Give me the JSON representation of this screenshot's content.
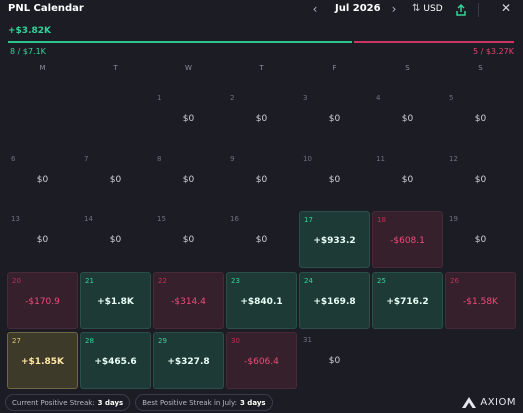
{
  "header": {
    "title": "PNL Calendar",
    "month": "Jul 2026",
    "currency": "USD",
    "icons": [
      "chevron-left-icon",
      "chevron-right-icon",
      "swap-icon",
      "share-icon",
      "close-icon"
    ]
  },
  "summary": {
    "total": "+$3.82K",
    "wins": "8 / $7.1K",
    "losses": "5 / $3.27K",
    "win_fraction": 0.68,
    "colors": {
      "positive": "#35d39a",
      "negative": "#e1456f"
    }
  },
  "weekdays": [
    "M",
    "T",
    "W",
    "T",
    "F",
    "S",
    "S"
  ],
  "weeks": [
    [
      null,
      null,
      {
        "day": "1",
        "value": "$0",
        "kind": "zero"
      },
      {
        "day": "2",
        "value": "$0",
        "kind": "zero"
      },
      {
        "day": "3",
        "value": "$0",
        "kind": "zero"
      },
      {
        "day": "4",
        "value": "$0",
        "kind": "zero"
      },
      {
        "day": "5",
        "value": "$0",
        "kind": "zero"
      }
    ],
    [
      {
        "day": "6",
        "value": "$0",
        "kind": "zero"
      },
      {
        "day": "7",
        "value": "$0",
        "kind": "zero"
      },
      {
        "day": "8",
        "value": "$0",
        "kind": "zero"
      },
      {
        "day": "9",
        "value": "$0",
        "kind": "zero"
      },
      {
        "day": "10",
        "value": "$0",
        "kind": "zero"
      },
      {
        "day": "11",
        "value": "$0",
        "kind": "zero"
      },
      {
        "day": "12",
        "value": "$0",
        "kind": "zero"
      }
    ],
    [
      {
        "day": "13",
        "value": "$0",
        "kind": "zero"
      },
      {
        "day": "14",
        "value": "$0",
        "kind": "zero"
      },
      {
        "day": "15",
        "value": "$0",
        "kind": "zero"
      },
      {
        "day": "16",
        "value": "$0",
        "kind": "zero"
      },
      {
        "day": "17",
        "value": "+$933.2",
        "kind": "pos"
      },
      {
        "day": "18",
        "value": "-$608.1",
        "kind": "neg"
      },
      {
        "day": "19",
        "value": "$0",
        "kind": "zero"
      }
    ],
    [
      {
        "day": "20",
        "value": "-$170.9",
        "kind": "neg"
      },
      {
        "day": "21",
        "value": "+$1.8K",
        "kind": "pos"
      },
      {
        "day": "22",
        "value": "-$314.4",
        "kind": "neg"
      },
      {
        "day": "23",
        "value": "+$840.1",
        "kind": "pos"
      },
      {
        "day": "24",
        "value": "+$169.8",
        "kind": "pos"
      },
      {
        "day": "25",
        "value": "+$716.2",
        "kind": "pos"
      },
      {
        "day": "26",
        "value": "-$1.58K",
        "kind": "neg"
      }
    ],
    [
      {
        "day": "27",
        "value": "+$1.85K",
        "kind": "best"
      },
      {
        "day": "28",
        "value": "+$465.6",
        "kind": "pos"
      },
      {
        "day": "29",
        "value": "+$327.8",
        "kind": "pos"
      },
      {
        "day": "30",
        "value": "-$606.4",
        "kind": "neg"
      },
      {
        "day": "31",
        "value": "$0",
        "kind": "zero"
      },
      null,
      null
    ]
  ],
  "footer": {
    "current_streak_label": "Current Positive Streak:",
    "current_streak_value": "3 days",
    "best_streak_label": "Best Positive Streak in July:",
    "best_streak_value": "3 days",
    "brand": "AXIOM"
  }
}
